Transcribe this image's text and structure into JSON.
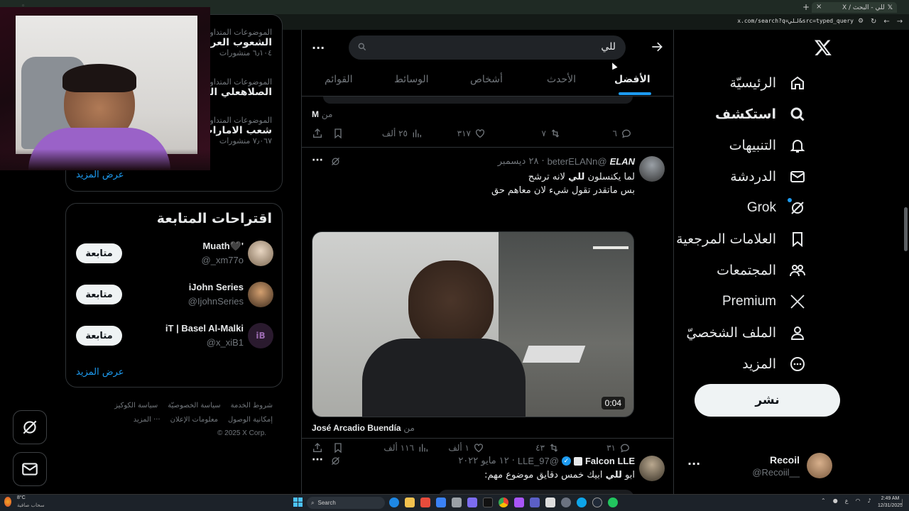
{
  "browser": {
    "tab_title": "للي - البحث / X",
    "url": "x.com/search?q=للي&src=typed_query"
  },
  "nav": {
    "items": [
      {
        "label": "الرئيسيّة",
        "icon": "home-icon"
      },
      {
        "label": "استكشف",
        "icon": "search-icon"
      },
      {
        "label": "التنبيهات",
        "icon": "bell-icon"
      },
      {
        "label": "الدردشة",
        "icon": "mail-icon"
      },
      {
        "label": "Grok",
        "icon": "grok-icon"
      },
      {
        "label": "العلامات المرجعية",
        "icon": "bookmark-icon"
      },
      {
        "label": "المجتمعات",
        "icon": "communities-icon"
      },
      {
        "label": "Premium",
        "icon": "x-logo-icon"
      },
      {
        "label": "الملف الشخصيّ",
        "icon": "profile-icon"
      },
      {
        "label": "المزيد",
        "icon": "more-circle-icon"
      }
    ],
    "post_label": "نشر",
    "account": {
      "name": "Recoil",
      "handle": "@Recoiil__"
    }
  },
  "search": {
    "query": "للي",
    "tabs": [
      "الأفضل",
      "الأحدث",
      "أشخاص",
      "الوسائط",
      "القوائم"
    ],
    "active_tab": "الأفضل"
  },
  "feed": {
    "prev_tweet": {
      "from_prefix": "من",
      "from_name": "M",
      "replies": "٦",
      "retweets": "٧",
      "likes": "٣١٧",
      "views": "٢٥ ألف"
    },
    "tweet1": {
      "name": "ELAN",
      "handle": "@beterELANn",
      "date": "٢٨ ديسمبر",
      "line1_pre": "لما يكنسلون ",
      "line1_bold": "للي",
      "line1_post": " لانه ترشح",
      "line2": "بس ماتقدر تقول شيء لان معاهم حق",
      "video_duration": "0:04",
      "from_prefix": "من",
      "from_name": "José Arcadio Buendía",
      "replies": "٣١",
      "retweets": "٤٣",
      "likes": "١ ألف",
      "views": "١١٦ ألف"
    },
    "tweet2": {
      "name": "Falcon LLE",
      "handle": "@LLE_97",
      "date": "١٢ مايو ٢٠٢٢",
      "text_pre": "ابو ",
      "text_bold": "للي",
      "text_post": " ابيك خمس دقايق موضوع مهم:"
    }
  },
  "trends": {
    "items": [
      {
        "category": "الموضوعات المتداولة",
        "name": "الشعوب العربية",
        "count": "٦٫١٠٤ منشورات"
      },
      {
        "category": "الموضوعات المتداولة",
        "name": "الصلاهعلي النبي",
        "count": ""
      },
      {
        "category": "الموضوعات المتداولة",
        "name": "شعب الامارات",
        "count": "٧٫٠٦٧ منشورات"
      }
    ],
    "show_more": "عرض المزيد"
  },
  "follow": {
    "title": "اقتراحات المتابعة",
    "users": [
      {
        "name": "Muath🖤'",
        "handle": "@_xm77o",
        "button": "متابعة"
      },
      {
        "name": "iJohn Series",
        "handle": "@IjohnSeries",
        "button": "متابعة"
      },
      {
        "name": "iT | Basel Al-Malki",
        "handle": "@x_xiB1",
        "button": "متابعة"
      }
    ],
    "show_more": "عرض المزيد"
  },
  "footer": {
    "links1": [
      "شروط الخدمة",
      "سياسة الخصوصيّة",
      "سياسة الكوكيز"
    ],
    "links2": [
      "إمكانية الوصول",
      "معلومات الإعلان",
      "··· المزيد"
    ],
    "copyright": "© 2025 X Corp."
  },
  "taskbar": {
    "weather_temp": "8°C",
    "weather_desc": "سحاب صافية",
    "search_placeholder": "Search",
    "time": "2:49 AM",
    "date": "12/31/2025"
  },
  "colors": {
    "accent": "#1d9bf0",
    "verified": "#1d9bf0"
  }
}
